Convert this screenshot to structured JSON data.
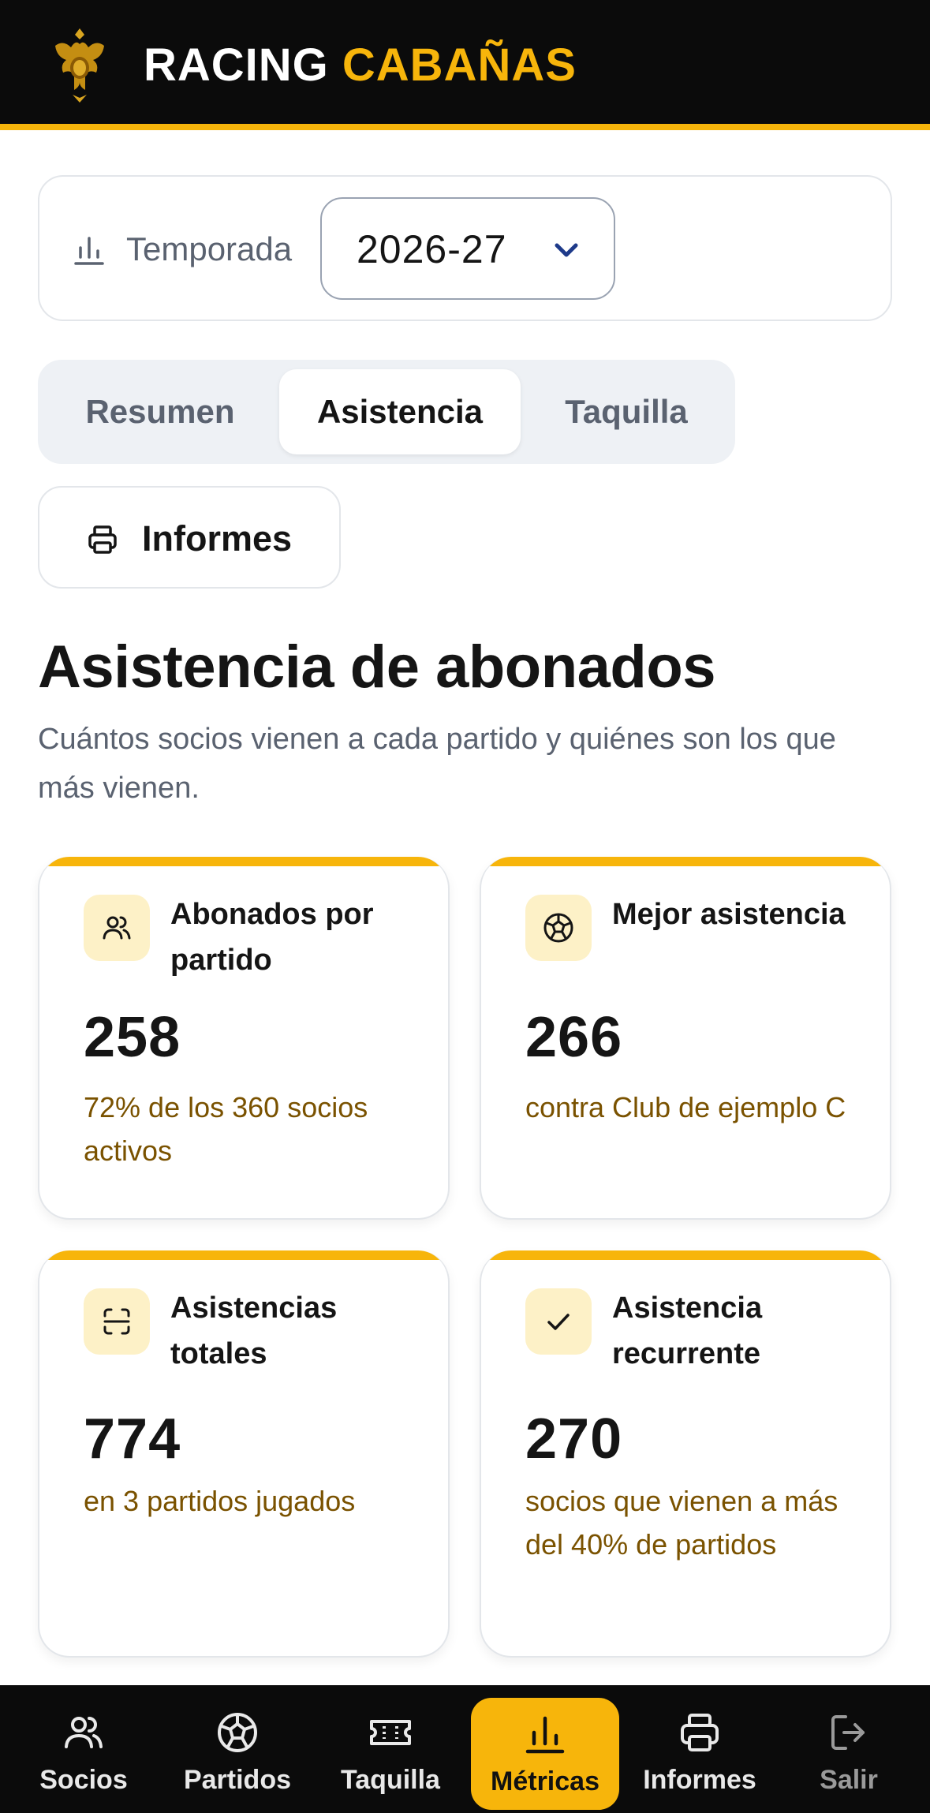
{
  "header": {
    "brand_white": "RACING",
    "brand_yellow": "CABAÑAS"
  },
  "season": {
    "label": "Temporada",
    "value": "2026-27"
  },
  "tabs": [
    {
      "label": "Resumen",
      "active": false
    },
    {
      "label": "Asistencia",
      "active": true
    },
    {
      "label": "Taquilla",
      "active": false
    }
  ],
  "report_button": {
    "label": "Informes"
  },
  "section": {
    "title": "Asistencia de abonados",
    "subtitle": "Cuántos socios vienen a cada partido y quiénes son los que más vienen."
  },
  "metrics": [
    {
      "title": "Abonados por partido",
      "value": "258",
      "note": "72% de los 360 socios activos",
      "icon": "users-icon"
    },
    {
      "title": "Mejor asistencia",
      "value": "266",
      "note": "contra Club de ejemplo C",
      "icon": "ball-icon"
    },
    {
      "title": "Asistencias totales",
      "value": "774",
      "note": "en 3 partidos jugados",
      "icon": "scan-icon"
    },
    {
      "title": "Asistencia recurrente",
      "value": "270",
      "note": "socios que vienen a más del 40% de partidos",
      "icon": "check-icon"
    }
  ],
  "nav": [
    {
      "label": "Socios",
      "icon": "users-icon",
      "active": false
    },
    {
      "label": "Partidos",
      "icon": "ball-icon",
      "active": false
    },
    {
      "label": "Taquilla",
      "icon": "ticket-icon",
      "active": false
    },
    {
      "label": "Métricas",
      "icon": "bar-chart-icon",
      "active": true
    },
    {
      "label": "Informes",
      "icon": "printer-icon",
      "active": false
    },
    {
      "label": "Salir",
      "icon": "logout-icon",
      "active": false
    }
  ],
  "colors": {
    "accent": "#f7b50b",
    "header_bg": "#0b0b0b",
    "note_text": "#7a5200"
  }
}
